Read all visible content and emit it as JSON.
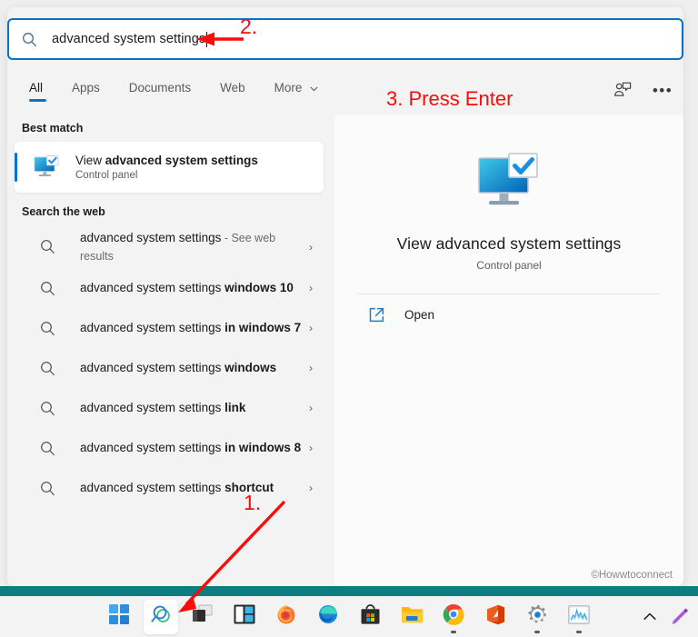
{
  "search": {
    "query": "advanced system settings",
    "icon": "search-icon"
  },
  "tabs": [
    {
      "label": "All",
      "active": true
    },
    {
      "label": "Apps",
      "active": false
    },
    {
      "label": "Documents",
      "active": false
    },
    {
      "label": "Web",
      "active": false
    },
    {
      "label": "More",
      "active": false,
      "chevron": "⌄"
    }
  ],
  "header_icons": {
    "feedback": "feedback-person-icon",
    "more": "•••"
  },
  "best_match": {
    "section_label": "Best match",
    "title_prefix": "View ",
    "title_bold": "advanced system settings",
    "subtitle": "Control panel",
    "icon": "advanced-system-settings-icon"
  },
  "web_section": {
    "label": "Search the web",
    "suggestions": [
      {
        "normal": "advanced system settings",
        "bold": "",
        "suffix": " - See web results"
      },
      {
        "normal": "advanced system settings ",
        "bold": "windows 10",
        "suffix": ""
      },
      {
        "normal": "advanced system settings ",
        "bold": "in windows 7",
        "suffix": ""
      },
      {
        "normal": "advanced system settings ",
        "bold": "windows",
        "suffix": ""
      },
      {
        "normal": "advanced system settings ",
        "bold": "link",
        "suffix": ""
      },
      {
        "normal": "advanced system settings ",
        "bold": "in windows 8",
        "suffix": ""
      },
      {
        "normal": "advanced system settings ",
        "bold": "shortcut",
        "suffix": ""
      }
    ],
    "chevron": "›"
  },
  "preview": {
    "title": "View advanced system settings",
    "subtitle": "Control panel",
    "action_label": "Open",
    "action_icon": "open-external-icon"
  },
  "watermark": "©Howwtoconnect",
  "annotations": {
    "step1": "1.",
    "step2": "2.",
    "step3": "3. Press Enter",
    "color": "#fd0b0b"
  },
  "taskbar": {
    "items": [
      {
        "name": "start",
        "running": false,
        "selected": false
      },
      {
        "name": "search",
        "running": false,
        "selected": true
      },
      {
        "name": "task-view",
        "running": false,
        "selected": false
      },
      {
        "name": "widgets",
        "running": false,
        "selected": false
      },
      {
        "name": "firefox",
        "running": false,
        "selected": false
      },
      {
        "name": "edge",
        "running": false,
        "selected": false
      },
      {
        "name": "microsoft-store",
        "running": false,
        "selected": false
      },
      {
        "name": "file-explorer",
        "running": false,
        "selected": false
      },
      {
        "name": "chrome",
        "running": true,
        "selected": false
      },
      {
        "name": "office",
        "running": false,
        "selected": false
      },
      {
        "name": "settings",
        "running": true,
        "selected": false
      },
      {
        "name": "task-manager",
        "running": true,
        "selected": false
      }
    ],
    "tray": {
      "show_hidden": "⌃",
      "pen": "pen-icon"
    }
  },
  "colors": {
    "accent": "#0a72c5",
    "panel_bg": "#f3f3f3",
    "preview_bg": "#fbfbfb",
    "teal_band": "#0d7d81",
    "annotation_red": "#fd0b0b"
  }
}
